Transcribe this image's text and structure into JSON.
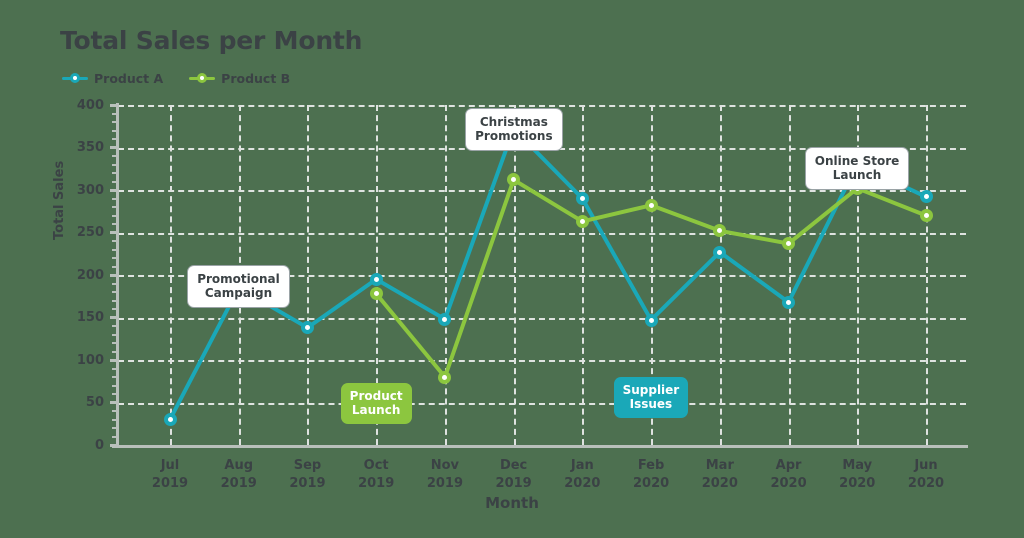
{
  "chart_data": {
    "type": "line",
    "title": "Total Sales per Month",
    "xlabel": "Month",
    "ylabel": "Total Sales",
    "categories": [
      "Jul 2019",
      "Aug 2019",
      "Sep 2019",
      "Oct 2019",
      "Nov 2019",
      "Dec 2019",
      "Jan 2020",
      "Feb 2020",
      "Mar 2020",
      "Apr 2020",
      "May 2020",
      "Jun 2020"
    ],
    "tick_labels": [
      [
        "Jul",
        "2019"
      ],
      [
        "Aug",
        "2019"
      ],
      [
        "Sep",
        "2019"
      ],
      [
        "Oct",
        "2019"
      ],
      [
        "Nov",
        "2019"
      ],
      [
        "Dec",
        "2019"
      ],
      [
        "Jan",
        "2020"
      ],
      [
        "Feb",
        "2020"
      ],
      [
        "Mar",
        "2020"
      ],
      [
        "Apr",
        "2020"
      ],
      [
        "May",
        "2020"
      ],
      [
        "Jun",
        "2020"
      ]
    ],
    "series": [
      {
        "name": "Product A",
        "color": "#1aa8b8",
        "values": [
          30,
          185,
          138,
          195,
          148,
          372,
          290,
          147,
          227,
          168,
          330,
          292
        ]
      },
      {
        "name": "Product B",
        "color": "#8cc63f",
        "values": [
          null,
          null,
          null,
          178,
          80,
          312,
          263,
          282,
          252,
          237,
          302,
          270
        ]
      }
    ],
    "ylim": [
      0,
      400
    ],
    "yticks": [
      0,
      50,
      100,
      150,
      200,
      250,
      300,
      350,
      400
    ],
    "ytick_labels": [
      "0",
      "50",
      "100",
      "150",
      "200",
      "250",
      "300",
      "350",
      "400"
    ],
    "yminor_step": 10,
    "grid": true,
    "grid_color": "#dfe3e0",
    "legend_position": "top-left",
    "background_color": "#4d7050",
    "text_color": "#3b4245",
    "annotations": [
      {
        "label": "Promotional Campaign",
        "lines": [
          "Promotional",
          "Campaign"
        ],
        "category": "Aug 2019",
        "series": "Product A",
        "value": 185,
        "style": "light"
      },
      {
        "label": "Product Launch",
        "lines": [
          "Product",
          "Launch"
        ],
        "category": "Oct 2019",
        "series": "Product B",
        "value": 178,
        "style": "green"
      },
      {
        "label": "Christmas Promotions",
        "lines": [
          "Christmas",
          "Promotions"
        ],
        "category": "Dec 2019",
        "series": "Product A",
        "value": 372,
        "style": "light"
      },
      {
        "label": "Supplier Issues",
        "lines": [
          "Supplier",
          "Issues"
        ],
        "category": "Feb 2020",
        "series": "Product A",
        "value": 147,
        "style": "teal"
      },
      {
        "label": "Online Store Launch",
        "lines": [
          "Online Store",
          "Launch"
        ],
        "category": "May 2020",
        "series": "Product A",
        "value": 330,
        "style": "light"
      }
    ]
  },
  "legend": {
    "items": [
      {
        "label": "Product A",
        "color": "#1aa8b8"
      },
      {
        "label": "Product B",
        "color": "#8cc63f"
      }
    ]
  }
}
